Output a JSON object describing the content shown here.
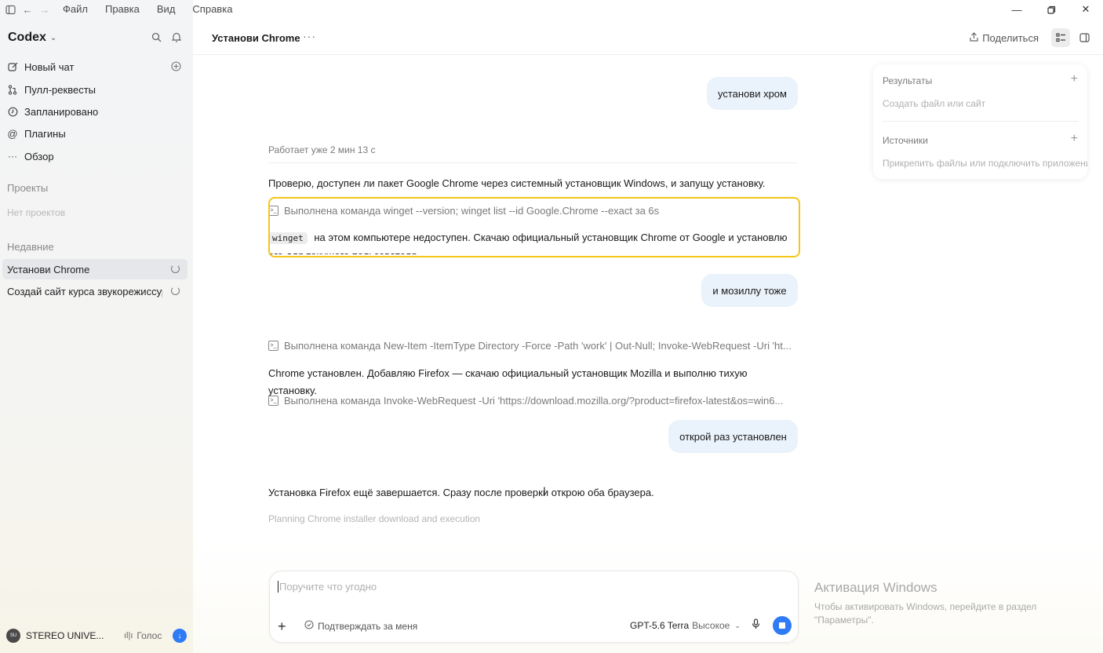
{
  "menu": [
    "Файл",
    "Правка",
    "Вид",
    "Справка"
  ],
  "sidebar": {
    "brand": "Codex",
    "nav": [
      {
        "label": "Новый чат",
        "icon": "edit-icon"
      },
      {
        "label": "Пулл-реквесты",
        "icon": "pull-request-icon"
      },
      {
        "label": "Запланировано",
        "icon": "clock-icon"
      },
      {
        "label": "Плагины",
        "icon": "plugin-icon"
      },
      {
        "label": "Обзор",
        "icon": "more-icon"
      }
    ],
    "projects_label": "Проекты",
    "projects_empty": "Нет проектов",
    "recent_label": "Недавние",
    "recent": [
      {
        "label": "Установи Chrome"
      },
      {
        "label": "Создай сайт курса звукорежиссуры"
      }
    ],
    "user": {
      "avatar": "SU",
      "name": "STEREO UNIVE..."
    },
    "voice_label": "Голос"
  },
  "header": {
    "title": "Установи Chrome",
    "share_label": "Поделиться"
  },
  "chat": {
    "user1": "установи хром",
    "status": "Работает уже 2 мин 13 с",
    "msg1": "Проверю, доступен ли пакет Google Chrome через системный установщик Windows, и запущу установку.",
    "cmd1": "Выполнена команда winget --version; winget list --id Google.Chrome --exact за 6s",
    "msg2_code": "winget",
    "msg2_text": "на этом компьютере недоступен. Скачаю официальный установщик Chrome от Google и установлю его для текущего пользователя.",
    "user2": "и мозиллу тоже",
    "cmd2": "Выполнена команда New-Item -ItemType Directory -Force -Path 'work' | Out-Null; Invoke-WebRequest -Uri 'ht...",
    "msg3": "Chrome установлен. Добавляю Firefox — скачаю официальный установщик Mozilla и выполню тихую установку.",
    "cmd3": "Выполнена команда Invoke-WebRequest -Uri 'https://download.mozilla.org/?product=firefox-latest&os=win6...",
    "user3": "открой раз установлен",
    "msg4": "Установка Firefox ещё завершается. Сразу после проверки открою оба браузера.",
    "planning": "Planning Chrome installer download and execution"
  },
  "panel": {
    "results_title": "Результаты",
    "results_sub": "Создать файл или сайт",
    "sources_title": "Источники",
    "sources_sub": "Прикрепить файлы или подключить приложения"
  },
  "composer": {
    "placeholder": "Поручите что угодно",
    "approve": "Подтверждать за меня",
    "model": "GPT-5.6 Terra",
    "level": "Высокое"
  },
  "watermark": {
    "title": "Активация Windows",
    "text": "Чтобы активировать Windows, перейдите в раздел \"Параметры\"."
  },
  "colors": {
    "accent": "#2f7bf5",
    "highlight": "#f5c518",
    "bubble": "#eaf2fb"
  }
}
